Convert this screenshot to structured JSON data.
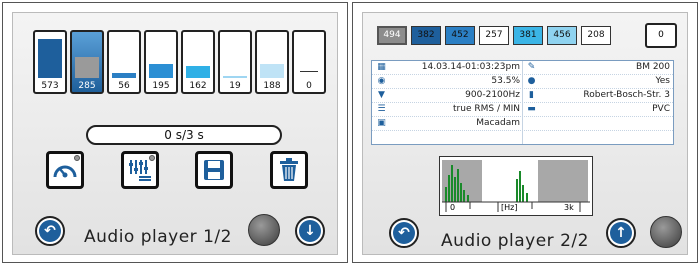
{
  "page1": {
    "title": "Audio player 1/2",
    "tiles": [
      {
        "value": "573",
        "level": 0.85,
        "color": "#1e5f9c"
      },
      {
        "value": "285",
        "level": 0.45,
        "color": "#1e5f9c"
      },
      {
        "value": "56",
        "level": 0.1,
        "color": "#2b7fc4"
      },
      {
        "value": "195",
        "level": 0.3,
        "color": "#2b8fd4"
      },
      {
        "value": "162",
        "level": 0.27,
        "color": "#2fb0e6"
      },
      {
        "value": "19",
        "level": 0.05,
        "color": "#9fd6f2"
      },
      {
        "value": "188",
        "level": 0.3,
        "color": "#bfe3f6"
      }
    ],
    "zero_value": "0",
    "progress_text": "0 s/3 s"
  },
  "page2": {
    "title": "Audio player 2/2",
    "tiles": [
      {
        "value": "494",
        "color": "#8c8c8c",
        "text_color": "#ffffff"
      },
      {
        "value": "382",
        "color": "#1e5f9c",
        "text_color": "#111111"
      },
      {
        "value": "452",
        "color": "#2b7fc4",
        "text_color": "#111111"
      },
      {
        "value": "257",
        "color": "#ffffff",
        "text_color": "#111111"
      },
      {
        "value": "381",
        "color": "#3bb5e6",
        "text_color": "#111111"
      },
      {
        "value": "456",
        "color": "#8fd3f0",
        "text_color": "#111111"
      },
      {
        "value": "208",
        "color": "#ffffff",
        "text_color": "#111111"
      }
    ],
    "zero_value": "0",
    "info": {
      "datetime": "14.03.14-01:03:23pm",
      "device": "BM 200",
      "volume": "53.5%",
      "water": "Yes",
      "filter": "900-2100Hz",
      "location": "Robert-Bosch-Str. 3",
      "measure": "true RMS / MIN",
      "pipe": "PVC",
      "surface": "Macadam"
    },
    "spectrum": {
      "tick0": "0",
      "tick_hz": "[Hz]",
      "tick3k": "3k"
    }
  }
}
